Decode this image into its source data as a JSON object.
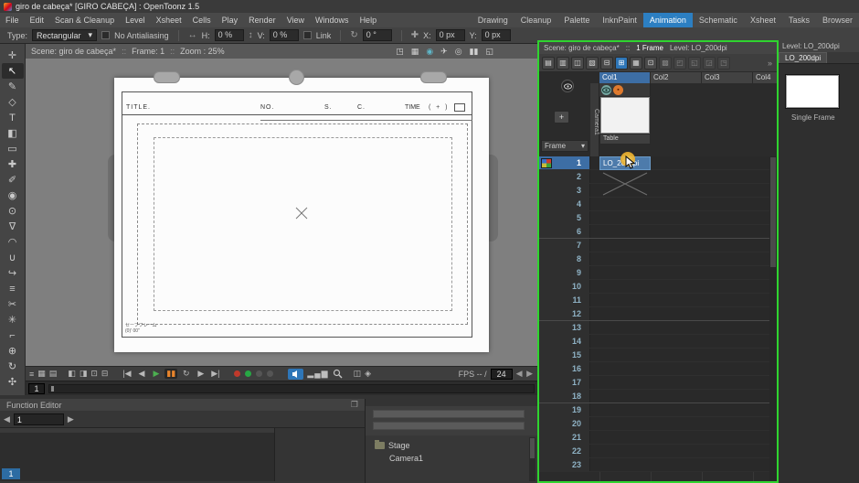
{
  "window": {
    "title": "giro de cabeça* [GIRO CABEÇA] : OpenToonz 1.5"
  },
  "colors": {
    "active_room_accent": "#2c7fc2",
    "selection_blue": "#3d6ea5",
    "active_panel_border": "#2fd42f",
    "record_red": "#c0392b",
    "play_green": "#4caf50",
    "pause_orange": "#e8842c"
  },
  "menubar": {
    "items": [
      "File",
      "Edit",
      "Scan & Cleanup",
      "Level",
      "Xsheet",
      "Cells",
      "Play",
      "Render",
      "View",
      "Windows",
      "Help"
    ],
    "rooms": [
      {
        "label": "Drawing"
      },
      {
        "label": "Cleanup"
      },
      {
        "label": "Palette"
      },
      {
        "label": "InknPaint"
      },
      {
        "label": "Animation",
        "cls": "active"
      },
      {
        "label": "Schematic"
      },
      {
        "label": "Xsheet"
      },
      {
        "label": "Tasks"
      },
      {
        "label": "Browser"
      }
    ]
  },
  "options": {
    "type_label": "Type:",
    "type_value": "Rectangular",
    "antialias_label": "No Antialiasing",
    "h_icon": "↔",
    "h_label": "H:",
    "h_value": "0 %",
    "v_icon": "↕",
    "v_label": "V:",
    "v_value": "0 %",
    "link_label": "Link",
    "rot_icon": "↻",
    "rot_value": "0 °",
    "pos_icon": "✚",
    "x_label": "X:",
    "x_value": "0 px",
    "y_label": "Y:",
    "y_value": "0 px"
  },
  "tools": [
    {
      "g": "✛",
      "name": "animate-tool"
    },
    {
      "g": "↖",
      "name": "selection-tool",
      "cls": "active"
    },
    {
      "g": "✎",
      "name": "brush-tool"
    },
    {
      "g": "◇",
      "name": "geometric-tool"
    },
    {
      "g": "T",
      "name": "type-tool"
    },
    {
      "g": "◧",
      "name": "fill-tool"
    },
    {
      "g": "▭",
      "name": "eraser-tool"
    },
    {
      "g": "✚",
      "name": "tape-tool"
    },
    {
      "g": "✐",
      "name": "style-picker-tool"
    },
    {
      "g": "◉",
      "name": "rgb-picker-tool"
    },
    {
      "g": "⊙",
      "name": "control-point-editor-tool"
    },
    {
      "g": "∇",
      "name": "pinch-tool"
    },
    {
      "g": "◠",
      "name": "pump-tool"
    },
    {
      "g": "∪",
      "name": "magnet-tool"
    },
    {
      "g": "↪",
      "name": "bender-tool"
    },
    {
      "g": "≡",
      "name": "iron-tool"
    },
    {
      "g": "✂",
      "name": "cutter-tool"
    },
    {
      "g": "✳",
      "name": "skeleton-tool"
    },
    {
      "g": "⌐",
      "name": "hook-tool"
    },
    {
      "g": "⊕",
      "name": "zoom-tool"
    },
    {
      "g": "↻",
      "name": "rotate-tool"
    },
    {
      "g": "✣",
      "name": "hand-tool"
    }
  ],
  "viewer": {
    "header": {
      "scene": "Scene: giro de cabeça*",
      "sep": "::",
      "frame": "Frame: 1",
      "zoom": "Zoom : 25%"
    },
    "header_icons": [
      {
        "g": "◳",
        "name": "safe-area-icon"
      },
      {
        "g": "▦",
        "name": "field-guide-icon"
      },
      {
        "g": "◉",
        "cls": "teal",
        "name": "camera-view-icon"
      },
      {
        "g": "✈",
        "name": "camera-3d-icon"
      },
      {
        "g": "◎",
        "name": "preview-icon"
      },
      {
        "g": "▮▮",
        "name": "freeze-icon"
      },
      {
        "g": "◱",
        "name": "sub-camera-icon"
      }
    ],
    "sheet": {
      "title_label": "TITLE.",
      "no_label": "NO.",
      "s_label": "S.",
      "c_label": "C.",
      "time_label": "TIME",
      "time_paren": "(   +   )",
      "safe_line1": "セーフフレーム",
      "safe_line2": "(0)' 00\""
    },
    "playback": {
      "left_icons": [
        {
          "g": "≡",
          "name": "console-menu-icon"
        },
        {
          "g": "▦",
          "name": "define-sub-camera-icon"
        },
        {
          "g": "▤",
          "name": "field-guide-toggle-icon"
        }
      ],
      "view_icons": [
        {
          "g": "◧",
          "name": "camera-stand-view-icon"
        },
        {
          "g": "◨",
          "name": "camera-3d-view-icon"
        },
        {
          "g": "⊡",
          "name": "camera-view-mode-icon"
        },
        {
          "g": "⊟",
          "name": "freeze-frame-icon"
        }
      ],
      "transport": [
        {
          "g": "|◀",
          "name": "first-frame-button"
        },
        {
          "g": "◀",
          "name": "prev-frame-button"
        },
        {
          "g": "▶",
          "cls": "play",
          "name": "play-button"
        },
        {
          "g": "▮▮",
          "cls": "pause",
          "name": "pause-button"
        },
        {
          "g": "↻",
          "name": "loop-button"
        },
        {
          "g": "▶",
          "name": "next-frame-button"
        },
        {
          "g": "▶|",
          "name": "last-frame-button"
        }
      ],
      "leds": [
        {
          "cls": "red",
          "name": "red-channel-led"
        },
        {
          "cls": "green",
          "name": "green-channel-led"
        },
        {
          "cls": "dim",
          "name": "blue-channel-led"
        },
        {
          "cls": "dim",
          "name": "matte-channel-led"
        }
      ],
      "histogram_glyph": "▂▄▆",
      "compare_icons": [
        {
          "g": "◫",
          "name": "compare-icon"
        },
        {
          "g": "◈",
          "name": "locator-icon"
        }
      ],
      "fps_label": "FPS -- /",
      "fps_value": "24",
      "fps_spinner": "◀ ▶"
    },
    "frame_value": "1"
  },
  "function_editor": {
    "title": "Function Editor",
    "prev_glyph": "◀",
    "next_glyph": "▶",
    "frame_value": "1",
    "current_badge": "1",
    "float_glyph": "❐"
  },
  "stage": {
    "folder_label": "Stage",
    "camera_label": "Camera1"
  },
  "xsheet": {
    "header": {
      "scene": "Scene: giro de cabeça*",
      "sep": "::",
      "frames": "1 Frame",
      "level": "Level: LO_200dpi"
    },
    "toolbar": [
      {
        "g": "▤"
      },
      {
        "g": "▥"
      },
      {
        "g": "◫"
      },
      {
        "g": "▧"
      },
      {
        "g": "⊟"
      },
      {
        "g": "⊞",
        "cls": "active"
      },
      {
        "g": "▦"
      },
      {
        "g": "⊡"
      },
      {
        "g": "▩",
        "cls": "dim"
      },
      {
        "g": "◰",
        "cls": "dim"
      },
      {
        "g": "◱",
        "cls": "dim"
      },
      {
        "g": "◲",
        "cls": "dim"
      },
      {
        "g": "◳",
        "cls": "dim"
      }
    ],
    "more_glyph": "»",
    "add_glyph": "+",
    "frame_dropdown": "Frame",
    "dd_chevron": "▾",
    "columns": [
      {
        "label": "Col1",
        "cls": "current"
      },
      {
        "label": "Col2"
      },
      {
        "label": "Col3"
      },
      {
        "label": "Col4"
      }
    ],
    "camera_label": "Camera1",
    "table_label": "Table",
    "cell_level": "LO_200dpi",
    "rows": [
      1,
      2,
      3,
      4,
      5,
      6,
      7,
      8,
      9,
      10,
      11,
      12,
      13,
      14,
      15,
      16,
      17,
      18,
      19,
      20,
      21,
      22,
      23
    ]
  },
  "level_strip": {
    "header": "Level: LO_200dpi",
    "tab": "LO_200dpi",
    "caption": "Single Frame"
  }
}
